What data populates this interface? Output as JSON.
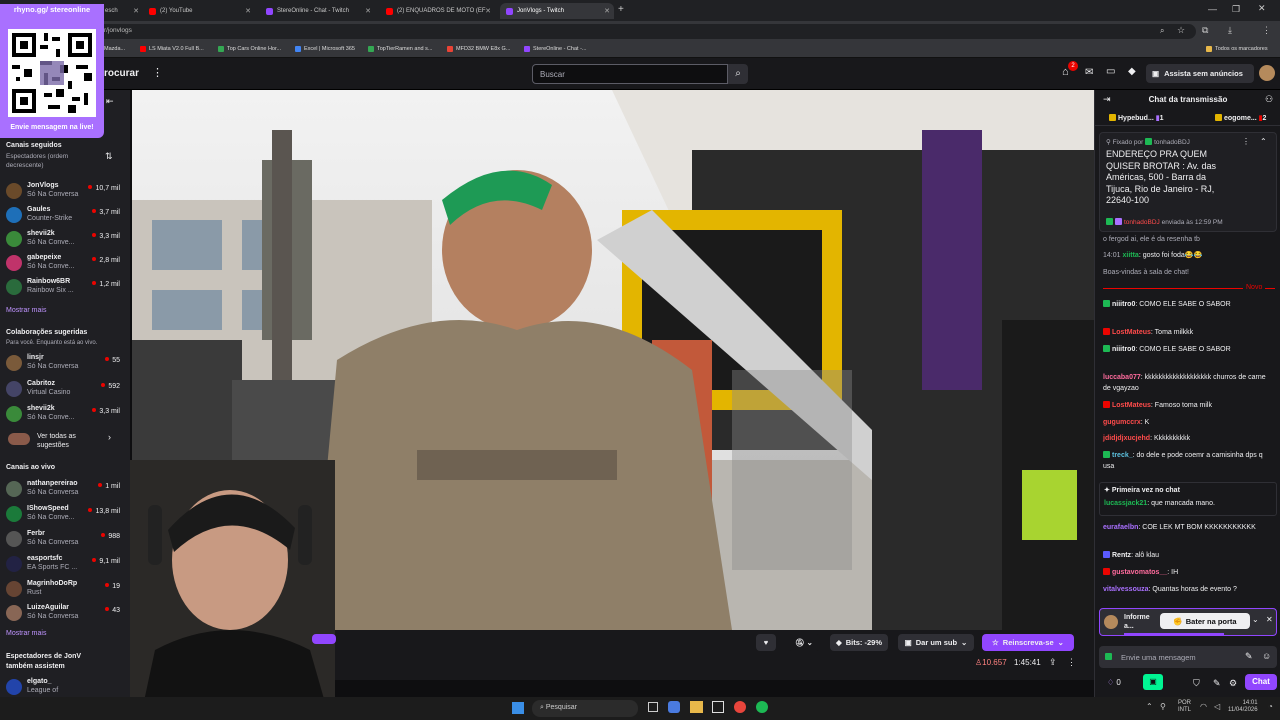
{
  "browser": {
    "tabs": [
      {
        "label": "esch",
        "color": "#ea4335"
      },
      {
        "label": "(2) YouTube",
        "color": "#ff0000"
      },
      {
        "label": "StereOnline - Chat - Twitch",
        "color": "#9146ff"
      },
      {
        "label": "(2) ENQUADROS DE MOTO (EF",
        "color": "#ff0000"
      },
      {
        "label": "JonVlogs - Twitch",
        "color": "#9146ff"
      }
    ],
    "url": "r/jonvlogs",
    "bookmarks": [
      {
        "label": "Mazda...",
        "color": "#888888"
      },
      {
        "label": "LS Miata V2.0 Full B...",
        "color": "#ff0000"
      },
      {
        "label": "Top Cars Online Hor...",
        "color": "#34a853"
      },
      {
        "label": "Excel | Microsoft 365",
        "color": "#4285f4"
      },
      {
        "label": "TopTierRamen and s...",
        "color": "#34a853"
      },
      {
        "label": "MFD32 BMW E8x G...",
        "color": "#ea4335"
      },
      {
        "label": "StereOnline - Chat -...",
        "color": "#9146ff"
      }
    ],
    "bookmarks_all": "Todos os marcadores"
  },
  "overlay": {
    "handle": "rhyno.gg/ stereonline",
    "message": "Envie mensagem na live!"
  },
  "topnav": {
    "procurar": "rocurar",
    "search_placeholder": "Buscar",
    "notif_count": "2",
    "ad_free": "Assista sem anúncios"
  },
  "sidebar": {
    "followed_title": "Canais seguidos",
    "followed_sub": "Espectadores (ordem decrescente)",
    "followed": [
      {
        "name": "JonVlogs",
        "game": "Só Na Conversa",
        "viewers": "10,7 mil",
        "color": "#6a4a2a"
      },
      {
        "name": "Gaules",
        "game": "Counter-Strike",
        "viewers": "3,7 mil",
        "color": "#1e6fb8"
      },
      {
        "name": "shevii2k",
        "game": "Só Na Conve...",
        "viewers": "3,3 mil",
        "color": "#3a8a3a"
      },
      {
        "name": "gabepeixe",
        "game": "Só Na Conve...",
        "viewers": "2,8 mil",
        "color": "#c0336a"
      },
      {
        "name": "Rainbow6BR",
        "game": "Rainbow Six ...",
        "viewers": "1,2 mil",
        "color": "#2a6b3c"
      }
    ],
    "show_more_1": "Mostrar mais",
    "collab_title": "Colaborações sugeridas",
    "collab_sub": "Para você. Enquanto está ao vivo.",
    "collab": [
      {
        "name": "linsjr",
        "game": "Só Na Conversa",
        "viewers": "55",
        "color": "#7a5a3a"
      },
      {
        "name": "Cabritoz",
        "game": "Virtual Casino",
        "viewers": "592",
        "color": "#444466"
      },
      {
        "name": "shevii2k",
        "game": "Só Na Conve...",
        "viewers": "3,3 mil",
        "color": "#3a8a3a"
      }
    ],
    "see_all": "Ver todas as sugestões",
    "live_title": "Canais ao vivo",
    "live": [
      {
        "name": "nathanpereirao",
        "game": "Só Na Conversa",
        "viewers": "1 mil",
        "color": "#556655"
      },
      {
        "name": "IShowSpeed",
        "game": "Só Na Conve...",
        "viewers": "13,8 mil",
        "color": "#1b7a3a"
      },
      {
        "name": "Ferbr",
        "game": "Só Na Conversa",
        "viewers": "988",
        "color": "#555555"
      },
      {
        "name": "easportsfc",
        "game": "EA Sports FC ...",
        "viewers": "9,1 mil",
        "color": "#222244"
      },
      {
        "name": "MagrinhoDoRp",
        "game": "Rust",
        "viewers": "19",
        "color": "#664433"
      },
      {
        "name": "LuizeAguilar",
        "game": "Só Na Conversa",
        "viewers": "43",
        "color": "#886655"
      }
    ],
    "show_more_2": "Mostrar mais",
    "viewers_also_title": "Espectadores de JonV também assistem",
    "also": [
      {
        "name": "elgato_",
        "game": "League of",
        "color": "#2244aa"
      }
    ]
  },
  "player": {
    "bits": "Bits: -29%",
    "gift": "Dar um sub",
    "resub": "Reinscreva-se",
    "viewers": "10.657",
    "uptime": "1:45:41"
  },
  "chat": {
    "title": "Chat da transmissão",
    "hype": "Hypebud...",
    "hype_count": "1",
    "hype2": "eogome...",
    "hype2_count": "2",
    "pinned_by": "Fixado por",
    "pinned_user": "tonhadoBDJ",
    "pinned_text": "ENDEREÇO PRA QUEM QUISER BROTAR : Av. das Américas, 500 - Barra da Tijuca, Rio de Janeiro - RJ, 22640-100",
    "pinned_sender": "tonhadoBDJ",
    "pinned_sent": "enviada às 12:59 PM",
    "prev_line": "o fergod ai, ele é da resenha tb",
    "time1": "14:01",
    "user0": "xiitta",
    "text0": ": gosto foi foda😂😂",
    "welcome": "Boas-vindas à sala de chat!",
    "new_label": "Novo",
    "messages": [
      {
        "user": "niiitro0",
        "color": "#efeff1",
        "text": ": COMO ELE SABE O SABOR"
      },
      {
        "user": "LostMateus",
        "color": "#ff4b4b",
        "text": ": Toma milkkk"
      },
      {
        "user": "niiitro0",
        "color": "#efeff1",
        "text": ": COMO ELE SABE O SABOR"
      },
      {
        "user": "luccaba077",
        "color": "#ff6b9d",
        "text": ": kkkkkkkkkkkkkkkkkkk churros de carne de vgayzao"
      },
      {
        "user": "LostMateus",
        "color": "#ff4b4b",
        "text": ": Famoso toma milk"
      },
      {
        "user": "gugumccrx",
        "color": "#ff4b4b",
        "text": ": K"
      },
      {
        "user": "jdidjdjxucjehd",
        "color": "#ff4b4b",
        "text": ": Kkkkkkkkkk"
      },
      {
        "user": "treck_",
        "color": "#5bc0de",
        "text": ": do dele e pode coemr a camisinha dps q usa"
      }
    ],
    "first_time": "Primeira vez no chat",
    "first_user": "lucassjack21",
    "first_text": ": que mancada mano.",
    "after": [
      {
        "user": "eurafaelbn",
        "color": "#a970ff",
        "text": ": COE LEK MT BOM KKKKKKKKKKK"
      },
      {
        "user": "Rentz",
        "color": "#efeff1",
        "text": ": alô klau"
      },
      {
        "user": "gustavomatos__",
        "color": "#ff6b9d",
        "text": ": IH"
      },
      {
        "user": "vitalvessouza",
        "color": "#a970ff",
        "text": ": Quantas horas de evento ?"
      }
    ],
    "inform": "Informe a...",
    "knock": "Bater na porta",
    "input_placeholder": "Envie uma mensagem",
    "points": "0",
    "chat_btn": "Chat"
  },
  "taskbar": {
    "search": "Pesquisar",
    "lang1": "POR",
    "lang2": "INTL",
    "time": "14:01",
    "date": "11/04/2026"
  }
}
